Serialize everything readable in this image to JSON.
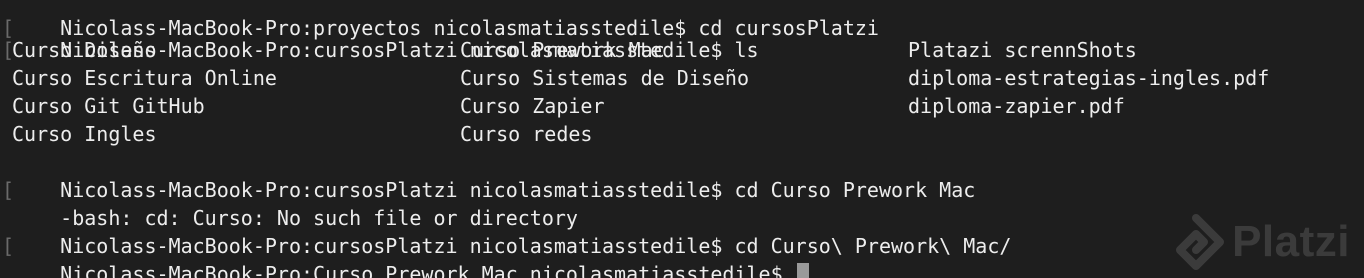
{
  "terminal": {
    "top_line": "Nicolass-MacBook-Pro:proyectos nicolasmatiasstedile$ cd cursosPlatzi",
    "lines": [
      {
        "text": "Nicolass-MacBook-Pro:cursosPlatzi nicolasmatiasstedile$ ls"
      },
      {
        "cols": [
          "Curso Diseño",
          "Curso Prework Mac",
          "Platazi scrennShots"
        ]
      },
      {
        "cols": [
          "Curso Escritura Online",
          "Curso Sistemas de Diseño",
          "diploma-estrategias-ingles.pdf"
        ]
      },
      {
        "cols": [
          "Curso Git GitHub",
          "Curso Zapier",
          "diploma-zapier.pdf"
        ]
      },
      {
        "cols": [
          "Curso Ingles",
          "Curso redes",
          ""
        ]
      },
      {
        "text": "Nicolass-MacBook-Pro:cursosPlatzi nicolasmatiasstedile$ cd Curso Prework Mac"
      },
      {
        "text": "-bash: cd: Curso: No such file or directory"
      },
      {
        "text": "Nicolass-MacBook-Pro:cursosPlatzi nicolasmatiasstedile$ cd Curso\\ Prework\\ Mac/"
      },
      {
        "text": "Nicolass-MacBook-Pro:Curso Prework Mac nicolasmatiasstedile$ "
      }
    ]
  },
  "watermark": {
    "brand": "Platzi",
    "color": "#ffffff"
  },
  "colors": {
    "background": "#1e1e1e",
    "foreground": "#ededed",
    "cursor": "#9a9a9a"
  }
}
